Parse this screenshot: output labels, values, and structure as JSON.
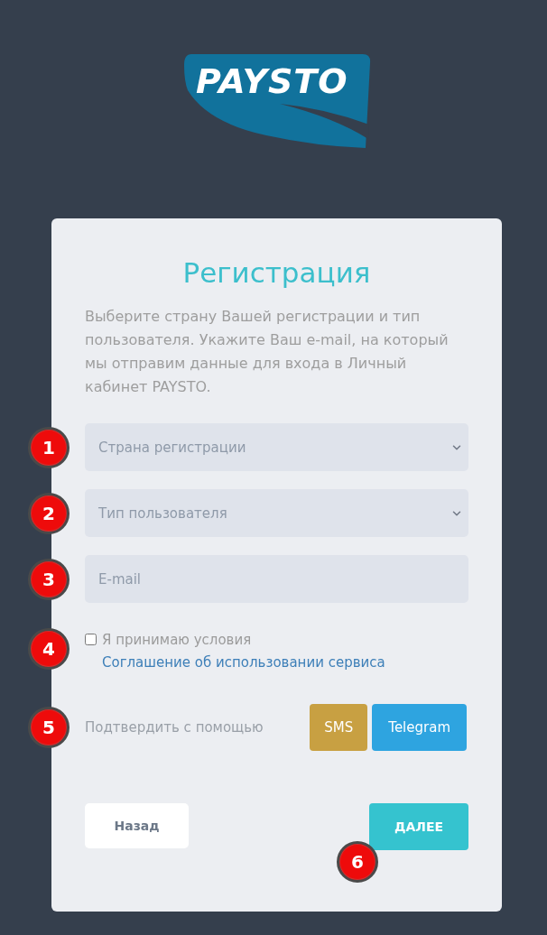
{
  "logo": {
    "text": "PAYSTO"
  },
  "form": {
    "title": "Регистрация",
    "description": "Выберите страну Вашей регистрации и тип пользователя. Укажите Ваш e-mail, на который мы отправим данные для входа в Личный кабинет PAYSTO.",
    "fields": [
      {
        "kind": "select",
        "placeholder": "Страна регистрации",
        "marker": "1"
      },
      {
        "kind": "select",
        "placeholder": "Тип пользователя",
        "marker": "2"
      },
      {
        "kind": "input",
        "placeholder": "E-mail",
        "marker": "3"
      }
    ],
    "agreement": {
      "checked": false,
      "text": "Я принимаю условия",
      "link": "Соглашение об использовании сервиса",
      "marker": "4"
    },
    "confirm": {
      "label": "Подтвердить с помощью",
      "options": [
        {
          "label": "SMS",
          "color": "#c8a042"
        },
        {
          "label": "Telegram",
          "color": "#2ea4e0"
        }
      ],
      "marker": "5"
    },
    "buttons": [
      {
        "kind": "secondary",
        "label": "Назад"
      },
      {
        "kind": "primary",
        "label": "ДАЛЕЕ",
        "marker": "6"
      }
    ]
  }
}
